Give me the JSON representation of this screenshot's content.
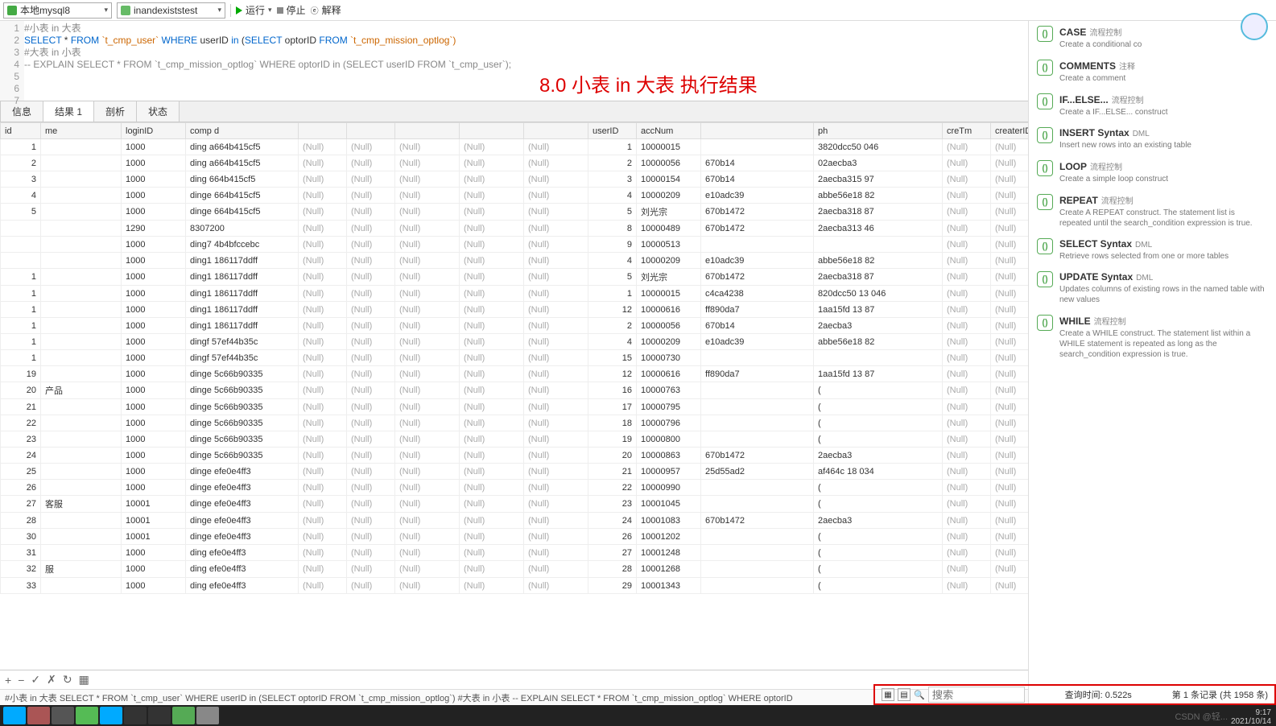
{
  "toolbar": {
    "connection": "本地mysql8",
    "database": "inandexiststest",
    "run": "运行",
    "stop": "停止",
    "explain": "解释"
  },
  "editor": {
    "lines": [
      "1",
      "2",
      "3",
      "4",
      "5",
      "6",
      "7"
    ],
    "l2": "#小表 in 大表",
    "l4a": "SELECT",
    "l4b": " * ",
    "l4c": "FROM",
    "l4d": " `t_cmp_user` ",
    "l4e": "WHERE",
    "l4f": " userID ",
    "l4g": "in",
    "l4h": " (",
    "l4i": "SELECT",
    "l4j": " optorID ",
    "l4k": "FROM",
    "l4l": " `t_cmp_mission_optlog`)",
    "l6": "#大表 in 小表",
    "l7": "-- EXPLAIN SELECT * FROM `t_cmp_mission_optlog` WHERE optorID in (SELECT userID FROM `t_cmp_user`);",
    "annotation": "8.0 小表 in 大表 执行结果"
  },
  "tabs": {
    "info": "信息",
    "result": "结果 1",
    "profile": "剖析",
    "status": "状态"
  },
  "cols": [
    "id",
    "  me",
    "loginID",
    "comp   d",
    "",
    "",
    "",
    "",
    "",
    "userID",
    "accNum",
    "",
    "ph   ",
    "creTm",
    "createrID"
  ],
  "rows": [
    {
      "id": "1",
      "me": "",
      "login": "1000",
      "comp": "ding      a664b415cf5",
      "uid": "1",
      "acc": "10000015",
      "c1": "",
      "ph": "3820dcc50        046",
      "cre": "(Null)",
      "crid": "(Null)"
    },
    {
      "id": "2",
      "me": "",
      "login": "1000",
      "comp": "ding      a664b415cf5",
      "uid": "2",
      "acc": "10000056",
      "c1": "670b14",
      "ph": "02aecba3",
      "cre": "(Null)",
      "crid": "(Null)"
    },
    {
      "id": "3",
      "me": "",
      "login": "1000",
      "comp": "ding      664b415cf5",
      "uid": "3",
      "acc": "10000154",
      "c1": "670b14",
      "ph": "2aecba315       97",
      "cre": "(Null)",
      "crid": "(Null)"
    },
    {
      "id": "4",
      "me": "",
      "login": "1000",
      "comp": "dinge     664b415cf5",
      "uid": "4",
      "acc": "10000209",
      "c1": "e10adc39",
      "ph": "abbe56e18      82",
      "cre": "(Null)",
      "crid": "(Null)"
    },
    {
      "id": "5",
      "me": "",
      "login": "1000",
      "comp": "dinge     664b415cf5",
      "uid": "5",
      "acc": "刘光宗",
      "c1": "670b1472",
      "ph": "2aecba318      87",
      "cre": "(Null)",
      "crid": "(Null)"
    },
    {
      "id": "",
      "me": "",
      "login": "1290",
      "comp": "          8307200",
      "uid": "8",
      "acc": "10000489",
      "c1": "670b1472",
      "ph": "2aecba313      46",
      "cre": "(Null)",
      "crid": "(Null)"
    },
    {
      "id": "",
      "me": "",
      "login": "1000",
      "comp": "ding7     4b4bfccebc",
      "uid": "9",
      "acc": "10000513",
      "c1": "",
      "ph": "",
      "cre": "(Null)",
      "crid": "(Null)"
    },
    {
      "id": "",
      "me": "",
      "login": "1000",
      "comp": "ding1     186117ddff",
      "uid": "4",
      "acc": "10000209",
      "c1": "e10adc39",
      "ph": "abbe56e18      82",
      "cre": "(Null)",
      "crid": "(Null)"
    },
    {
      "id": "1",
      "me": "",
      "login": "1000",
      "comp": "ding1     186117ddff",
      "uid": "5",
      "acc": "刘光宗",
      "c1": "670b1472",
      "ph": "2aecba318      87",
      "cre": "(Null)",
      "crid": "(Null)"
    },
    {
      "id": "1",
      "me": "",
      "login": "1000",
      "comp": "ding1     186117ddff",
      "uid": "1",
      "acc": "10000015",
      "c1": "c4ca4238",
      "ph": "820dcc50 13    046",
      "cre": "(Null)",
      "crid": "(Null)"
    },
    {
      "id": "1",
      "me": "",
      "login": "1000",
      "comp": "ding1     186117ddff",
      "uid": "12",
      "acc": "10000616",
      "c1": "ff890da7",
      "ph": "1aa15fd 13    87",
      "cre": "(Null)",
      "crid": "(Null)"
    },
    {
      "id": "1",
      "me": "",
      "login": "1000",
      "comp": "ding1     186117ddff",
      "uid": "2",
      "acc": "10000056",
      "c1": "670b14",
      "ph": "2aecba3",
      "cre": "(Null)",
      "crid": "(Null)"
    },
    {
      "id": "1",
      "me": "",
      "login": "1000",
      "comp": "dingf     57ef44b35c",
      "uid": "4",
      "acc": "10000209",
      "c1": "e10adc39",
      "ph": "abbe56e18     82",
      "cre": "(Null)",
      "crid": "(Null)"
    },
    {
      "id": "1",
      "me": "",
      "login": "1000",
      "comp": "dingf     57ef44b35c",
      "uid": "15",
      "acc": "10000730",
      "c1": "",
      "ph": "",
      "cre": "(Null)",
      "crid": "(Null)"
    },
    {
      "id": "19",
      "me": "",
      "login": "1000",
      "comp": "dinge     5c66b90335",
      "uid": "12",
      "acc": "10000616",
      "c1": "ff890da7",
      "ph": "1aa15fd 13   87",
      "cre": "(Null)",
      "crid": "(Null)"
    },
    {
      "id": "20",
      "me": "产品",
      "login": "1000",
      "comp": "dinge     5c66b90335",
      "uid": "16",
      "acc": "10000763",
      "c1": "",
      "ph": "(",
      "cre": "(Null)",
      "crid": "(Null)"
    },
    {
      "id": "21",
      "me": "",
      "login": "1000",
      "comp": "dinge     5c66b90335",
      "uid": "17",
      "acc": "10000795",
      "c1": "",
      "ph": "(",
      "cre": "(Null)",
      "crid": "(Null)"
    },
    {
      "id": "22",
      "me": "",
      "login": "1000",
      "comp": "dinge     5c66b90335",
      "uid": "18",
      "acc": "10000796",
      "c1": "",
      "ph": "(",
      "cre": "(Null)",
      "crid": "(Null)"
    },
    {
      "id": "23",
      "me": "",
      "login": "1000",
      "comp": "dinge     5c66b90335",
      "uid": "19",
      "acc": "10000800",
      "c1": "",
      "ph": "(",
      "cre": "(Null)",
      "crid": "(Null)"
    },
    {
      "id": "24",
      "me": "",
      "login": "1000",
      "comp": "dinge     5c66b90335",
      "uid": "20",
      "acc": "10000863",
      "c1": "670b1472",
      "ph": "2aecba3",
      "cre": "(Null)",
      "crid": "(Null)"
    },
    {
      "id": "25",
      "me": "",
      "login": "1000",
      "comp": "dinge     efe0e4ff3",
      "uid": "21",
      "acc": "10000957",
      "c1": "25d55ad2",
      "ph": "af464c 18     034",
      "cre": "(Null)",
      "crid": "(Null)"
    },
    {
      "id": "26",
      "me": "",
      "login": "1000",
      "comp": "dinge     efe0e4ff3",
      "uid": "22",
      "acc": "10000990",
      "c1": "",
      "ph": "(",
      "cre": "(Null)",
      "crid": "(Null)"
    },
    {
      "id": "27",
      "me": "客服",
      "login": "10001",
      "comp": "dinge     efe0e4ff3",
      "uid": "23",
      "acc": "10001045",
      "c1": "",
      "ph": "(",
      "cre": "(Null)",
      "crid": "(Null)"
    },
    {
      "id": "28",
      "me": "",
      "login": "10001",
      "comp": "dinge     efe0e4ff3",
      "uid": "24",
      "acc": "10001083",
      "c1": "670b1472",
      "ph": "2aecba3",
      "cre": "(Null)",
      "crid": "(Null)"
    },
    {
      "id": "30",
      "me": "",
      "login": "10001",
      "comp": "dinge     efe0e4ff3",
      "uid": "26",
      "acc": "10001202",
      "c1": "",
      "ph": "(",
      "cre": "(Null)",
      "crid": "(Null)"
    },
    {
      "id": "31",
      "me": "",
      "login": "1000",
      "comp": "ding      efe0e4ff3",
      "uid": "27",
      "acc": "10001248",
      "c1": "",
      "ph": "(",
      "cre": "(Null)",
      "crid": "(Null)"
    },
    {
      "id": "32",
      "me": "服",
      "login": "1000",
      "comp": "ding      efe0e4ff3",
      "uid": "28",
      "acc": "10001268",
      "c1": "",
      "ph": "(",
      "cre": "(Null)",
      "crid": "(Null)"
    },
    {
      "id": "33",
      "me": "",
      "login": "1000",
      "comp": "ding      efe0e4ff3",
      "uid": "29",
      "acc": "10001343",
      "c1": "",
      "ph": "(",
      "cre": "(Null)",
      "crid": "(Null)"
    }
  ],
  "null_label": "(Null)",
  "search_ph": "搜索",
  "stat": {
    "time": "查询时间: 0.522s",
    "rec": "第 1 条记录 (共 1958 条)"
  },
  "statusline": "#小表 in 大表  SELECT * FROM `t_cmp_user` WHERE userID in (SELECT optorID FROM `t_cmp_mission_optlog`)  #大表 in 小表 -- EXPLAIN SELECT * FROM `t_cmp_mission_optlog` WHERE optorID",
  "snippets": [
    {
      "t": "CASE",
      "s": "流程控制",
      "d": "Create a conditional co"
    },
    {
      "t": "COMMENTS",
      "s": "注释",
      "d": "Create a comment"
    },
    {
      "t": "IF...ELSE...",
      "s": "流程控制",
      "d": "Create a IF...ELSE... construct"
    },
    {
      "t": "INSERT Syntax",
      "s": "DML",
      "d": "Insert new rows into an existing table"
    },
    {
      "t": "LOOP",
      "s": "流程控制",
      "d": "Create a simple loop construct"
    },
    {
      "t": "REPEAT",
      "s": "流程控制",
      "d": "Create A REPEAT construct. The statement list is repeated until the search_condition expression is true."
    },
    {
      "t": "SELECT Syntax",
      "s": "DML",
      "d": "Retrieve rows selected from one or more tables"
    },
    {
      "t": "UPDATE Syntax",
      "s": "DML",
      "d": "Updates columns of existing rows in the named table with new values"
    },
    {
      "t": "WHILE",
      "s": "流程控制",
      "d": "Create a WHILE construct. The statement list within a WHILE statement is repeated as long as the search_condition expression is true."
    }
  ],
  "clock": {
    "t": "9:17",
    "d": "2021/10/14"
  },
  "wm": "CSDN @轻..."
}
